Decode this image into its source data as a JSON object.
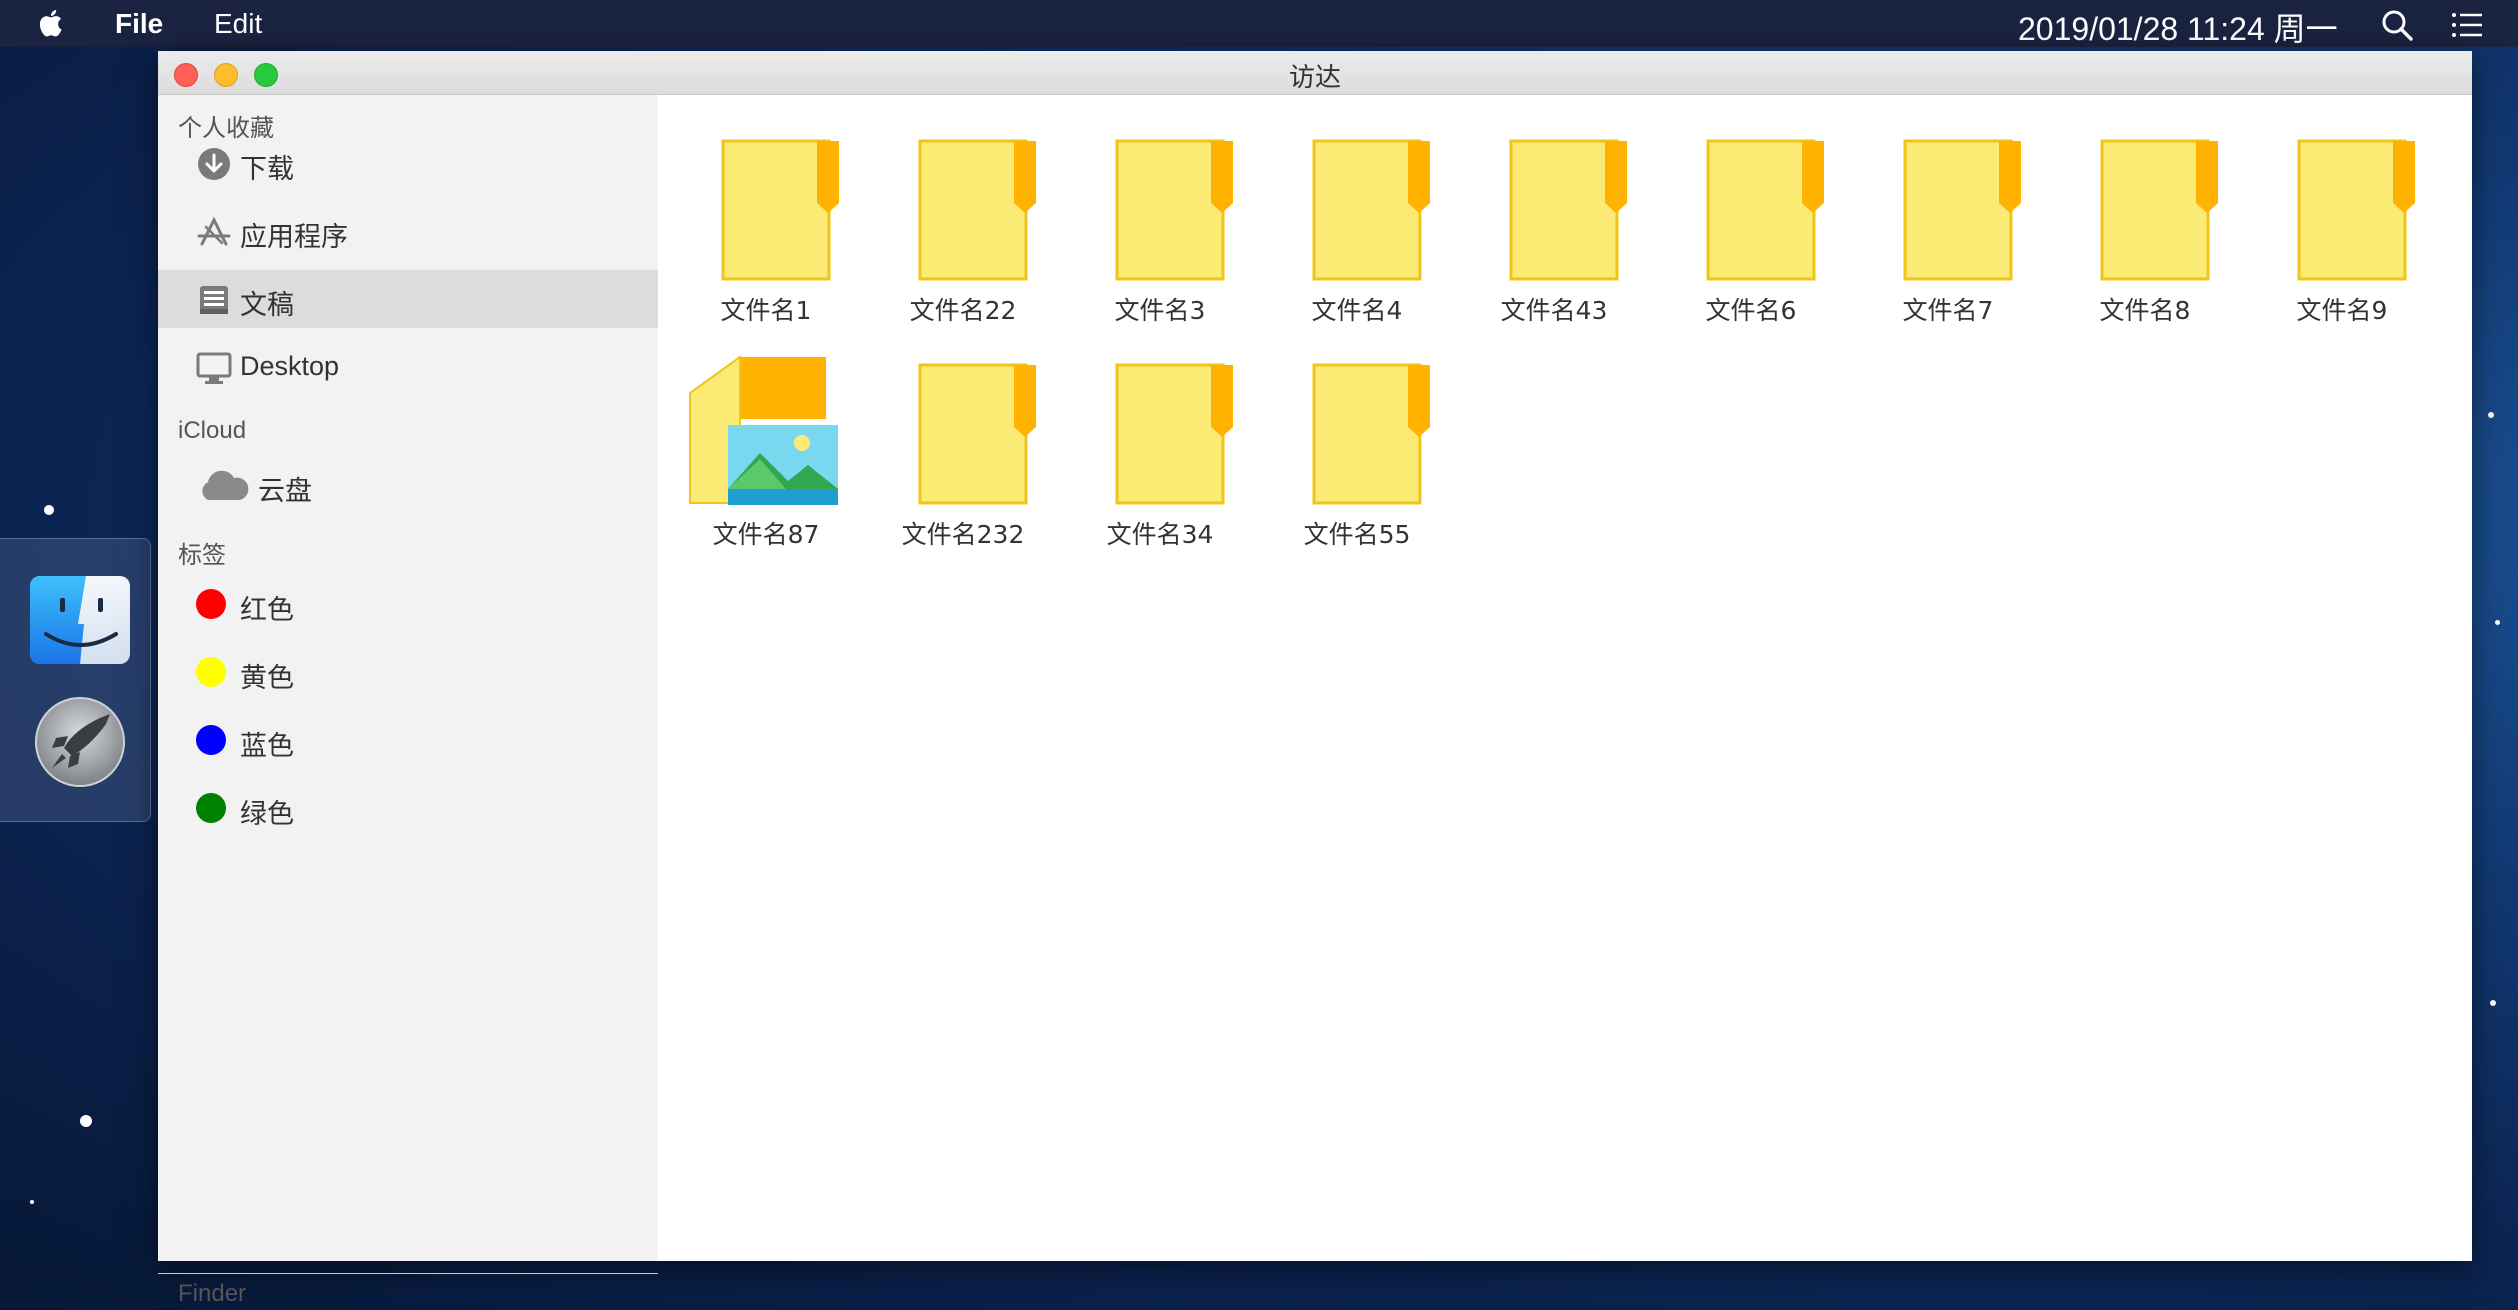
{
  "menubar": {
    "file": "File",
    "edit": "Edit",
    "datetime": "2019/01/28 11:24 周一"
  },
  "window": {
    "title": "访达"
  },
  "sidebar": {
    "favorites_label": "个人收藏",
    "favorites": [
      {
        "label": "下载",
        "icon": "download-icon"
      },
      {
        "label": "应用程序",
        "icon": "applications-icon"
      },
      {
        "label": "文稿",
        "icon": "documents-icon",
        "selected": true
      },
      {
        "label": "Desktop",
        "icon": "desktop-icon"
      }
    ],
    "icloud_label": "iCloud",
    "icloud": [
      {
        "label": "云盘",
        "icon": "cloud-icon"
      }
    ],
    "tags_label": "标签",
    "tags": [
      {
        "label": "红色",
        "color": "#ff0000"
      },
      {
        "label": "黄色",
        "color": "#ffff00"
      },
      {
        "label": "蓝色",
        "color": "#0000ff"
      },
      {
        "label": "绿色",
        "color": "#008000"
      }
    ],
    "footer": "Finder"
  },
  "files": [
    {
      "name": "文件名1",
      "icon": "document-icon"
    },
    {
      "name": "文件名22",
      "icon": "document-icon"
    },
    {
      "name": "文件名3",
      "icon": "document-icon"
    },
    {
      "name": "文件名4",
      "icon": "document-icon"
    },
    {
      "name": "文件名43",
      "icon": "document-icon"
    },
    {
      "name": "文件名6",
      "icon": "document-icon"
    },
    {
      "name": "文件名7",
      "icon": "document-icon"
    },
    {
      "name": "文件名8",
      "icon": "document-icon"
    },
    {
      "name": "文件名9",
      "icon": "document-icon"
    },
    {
      "name": "文件名87",
      "icon": "image-folder-icon"
    },
    {
      "name": "文件名232",
      "icon": "document-icon"
    },
    {
      "name": "文件名34",
      "icon": "document-icon"
    },
    {
      "name": "文件名55",
      "icon": "document-icon"
    }
  ],
  "colors": {
    "doc_fill": "#fbea74",
    "doc_border": "#f0c419",
    "doc_flag": "#ffb300"
  }
}
